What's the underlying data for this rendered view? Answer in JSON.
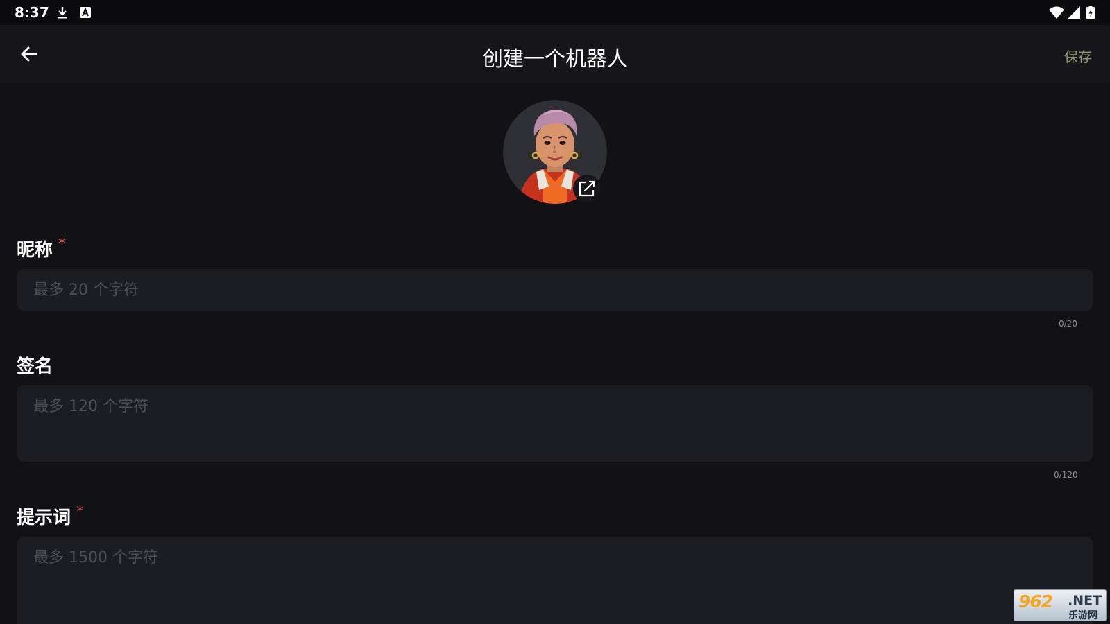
{
  "status_bar": {
    "time": "8:37",
    "left_icons": [
      "download-icon",
      "keyboard-a-icon"
    ],
    "right_icons": [
      "wifi-icon",
      "signal-icon",
      "battery-icon"
    ]
  },
  "app_bar": {
    "back_icon": "arrow-left-icon",
    "title": "创建一个机器人",
    "save_label": "保存"
  },
  "avatar": {
    "edit_icon": "edit-icon"
  },
  "form": {
    "nickname": {
      "label": "昵称",
      "required_mark": "*",
      "placeholder": "最多 20 个字符",
      "value": "",
      "counter": "0/20"
    },
    "signature": {
      "label": "签名",
      "placeholder": "最多 120 个字符",
      "value": "",
      "counter": "0/120"
    },
    "prompt": {
      "label": "提示词",
      "required_mark": "*",
      "placeholder": "最多 1500 个字符",
      "value": ""
    }
  },
  "watermark": {
    "number": "962",
    "suffix": ".NET",
    "subtitle": "乐游网"
  },
  "colors": {
    "background": "#121216",
    "app_bar": "#16161b",
    "input_bg": "#1c1d22",
    "save_accent": "#8d9a72",
    "required": "#c84c4c"
  }
}
